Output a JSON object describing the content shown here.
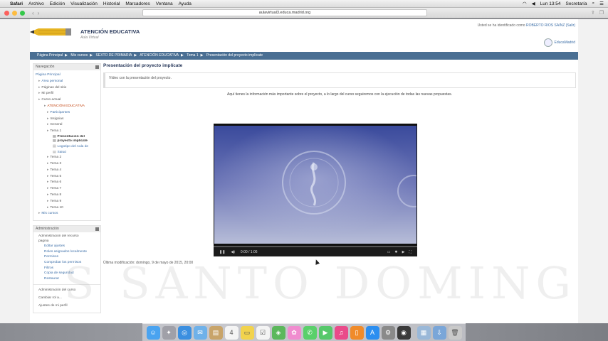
{
  "menubar": {
    "app": "Safari",
    "menus": [
      "Archivo",
      "Edición",
      "Visualización",
      "Historial",
      "Marcadores",
      "Ventana",
      "Ayuda"
    ],
    "clock": "Lun 13:54",
    "user": "Secretaría"
  },
  "browser": {
    "url": "aulavirtual3.educa.madrid.org"
  },
  "site": {
    "title": "ATENCIÓN EDUCATIVA",
    "subtitle": "Aula Virtual",
    "login_prefix": "Usted se ha identificado como",
    "login_user": "ROBERTO RIOS SAINZ",
    "login_suffix": "(Salir)",
    "brand": "EducaMadrid"
  },
  "breadcrumb": [
    "Página Principal",
    "Mis cursos",
    "SEXTO DE PRIMARIA",
    "ATENCIÓN EDUCATIVA",
    "Tema 1",
    "Presentación del proyecto implícate"
  ],
  "navigation": {
    "title": "Navegación",
    "home": "Página Principal",
    "items": [
      {
        "label": "Área personal",
        "level": 1,
        "style": "link"
      },
      {
        "label": "Páginas del sitio",
        "level": 1,
        "style": "plain"
      },
      {
        "label": "Mi perfil",
        "level": 1,
        "style": "plain"
      },
      {
        "label": "Curso actual",
        "level": 1,
        "style": "plain"
      },
      {
        "label": "ATENCIÓN EDUCATIVA",
        "level": 2,
        "style": "active"
      },
      {
        "label": "Participantes",
        "level": 3,
        "style": "link"
      },
      {
        "label": "Insignias",
        "level": 3,
        "style": "plain"
      },
      {
        "label": "General",
        "level": 3,
        "style": "plain"
      },
      {
        "label": "Tema 1",
        "level": 3,
        "style": "plain"
      },
      {
        "label": "Presentación del",
        "level": 4,
        "style": "current"
      },
      {
        "label": "proyecto implícate",
        "level": 4,
        "style": "current"
      },
      {
        "label": "Logotipo del Aula de",
        "level": 4,
        "style": "link"
      },
      {
        "label": "Salud",
        "level": 4,
        "style": "link"
      },
      {
        "label": "Tema 2",
        "level": 3,
        "style": "plain"
      },
      {
        "label": "Tema 3",
        "level": 3,
        "style": "plain"
      },
      {
        "label": "Tema 4",
        "level": 3,
        "style": "plain"
      },
      {
        "label": "Tema 5",
        "level": 3,
        "style": "plain"
      },
      {
        "label": "Tema 6",
        "level": 3,
        "style": "plain"
      },
      {
        "label": "Tema 7",
        "level": 3,
        "style": "plain"
      },
      {
        "label": "Tema 8",
        "level": 3,
        "style": "plain"
      },
      {
        "label": "Tema 9",
        "level": 3,
        "style": "plain"
      },
      {
        "label": "Tema 10",
        "level": 3,
        "style": "plain"
      },
      {
        "label": "Mis cursos",
        "level": 1,
        "style": "link"
      }
    ]
  },
  "administration": {
    "title": "Administración",
    "items": [
      {
        "label": "Administración del recurso",
        "level": 1,
        "style": "plain"
      },
      {
        "label": "página",
        "level": 1,
        "style": "plain"
      },
      {
        "label": "Editar ajustes",
        "level": 2,
        "style": "link"
      },
      {
        "label": "Roles asignados localmente",
        "level": 2,
        "style": "link"
      },
      {
        "label": "Permisos",
        "level": 2,
        "style": "link"
      },
      {
        "label": "Comprobar los permisos",
        "level": 2,
        "style": "link"
      },
      {
        "label": "Filtros",
        "level": 2,
        "style": "link"
      },
      {
        "label": "Copia de seguridad",
        "level": 2,
        "style": "link"
      },
      {
        "label": "Restaurar",
        "level": 2,
        "style": "link"
      }
    ],
    "footer_items": [
      "Administración del curso",
      "Cambiar rol a...",
      "Ajustes de mi perfil"
    ]
  },
  "main": {
    "title": "Presentación del proyecto implícate",
    "summary": "Vídeo con la presentación del proyecto.",
    "intro": "Aquí tienes la información más importante sobre el proyecto, a lo largo del curso seguiremos con la ejecución de todas las nuevas propuestas.",
    "video_time": "0:00 / 1:06",
    "video_progress": 0,
    "modified": "Última modificación: domingo, 9 de mayo de 2015, 20:00"
  },
  "watermark": "S SANTO DOMING",
  "colors": {
    "breadcrumb_bg": "#4a6f93",
    "link": "#3d6fa8",
    "active": "#c2410c"
  },
  "dock": [
    "finder-icon",
    "launchpad-icon",
    "safari-icon",
    "mail-icon",
    "contacts-icon",
    "calendar-icon",
    "notes-icon",
    "reminders-icon",
    "maps-icon",
    "photos-icon",
    "messages-icon",
    "facetime-icon",
    "itunes-icon",
    "ibooks-icon",
    "appstore-icon",
    "preferences-icon",
    "quicktime-icon",
    "documents-icon",
    "downloads-icon",
    "trash-icon"
  ]
}
